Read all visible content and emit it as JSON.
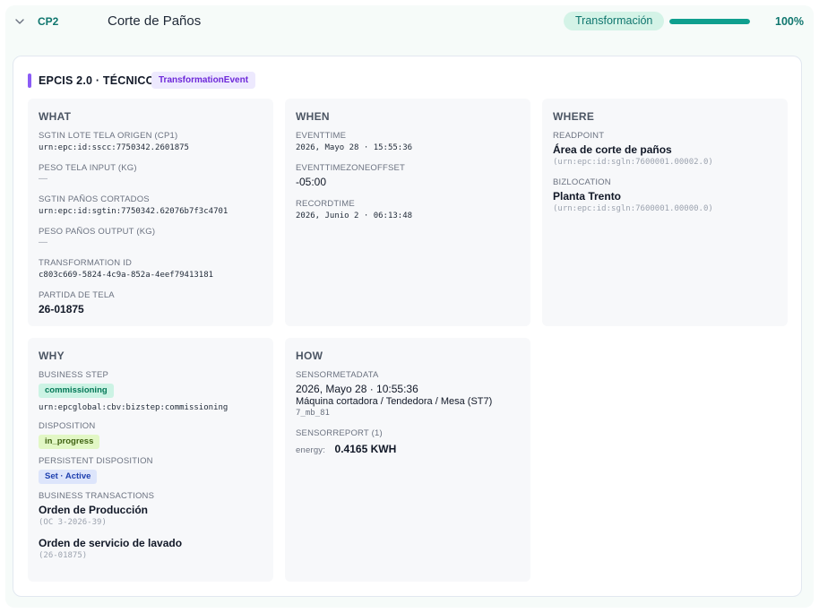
{
  "header": {
    "code": "CP2",
    "title": "Corte de Paños",
    "type_label": "Transformación",
    "progress_percent": 100,
    "progress_label": "100%",
    "accent_color": "#0f9f8f"
  },
  "card": {
    "title": "EPCIS 2.0 · TÉCNICO",
    "event_type": "TransformationEvent",
    "what": {
      "heading": "WHAT",
      "fields": [
        {
          "label": "SGTIN LOTE TELA ORIGEN (CP1)",
          "value": "urn:epc:id:sscc:7750342.2601875"
        },
        {
          "label": "PESO TELA INPUT (KG)",
          "value": "—"
        },
        {
          "label": "SGTIN PAÑOS CORTADOS",
          "value": "urn:epc:id:sgtin:7750342.62076b7f3c4701"
        },
        {
          "label": "PESO PAÑOS OUTPUT (KG)",
          "value": "—"
        },
        {
          "label": "TRANSFORMATION ID",
          "value": "c803c669-5824-4c9a-852a-4eef79413181"
        },
        {
          "label": "PARTIDA DE TELA",
          "value": "26-01875"
        }
      ]
    },
    "when": {
      "heading": "WHEN",
      "event_time_label": "EVENTTIME",
      "event_time": "2026, Mayo 28 · 15:55:36",
      "tz_label": "EVENTTIMEZONEOFFSET",
      "tz": "-05:00",
      "record_time_label": "RECORDTIME",
      "record_time": "2026, Junio 2 · 06:13:48"
    },
    "where": {
      "heading": "WHERE",
      "readpoint_label": "READPOINT",
      "readpoint_name": "Área de corte de paños",
      "readpoint_id": "(urn:epc:id:sgln:7600001.00002.0)",
      "bizlocation_label": "BIZLOCATION",
      "bizlocation_name": "Planta Trento",
      "bizlocation_id": "(urn:epc:id:sgln:7600001.00000.0)"
    },
    "why": {
      "heading": "WHY",
      "business_step_label": "BUSINESS STEP",
      "business_step": "commissioning",
      "business_step_urn": "urn:epcglobal:cbv:bizstep:commissioning",
      "disposition_label": "DISPOSITION",
      "disposition": "in_progress",
      "persistent_label": "PERSISTENT DISPOSITION",
      "persistent": "Set · Active",
      "transactions_label": "BUSINESS TRANSACTIONS",
      "transactions": [
        {
          "name": "Orden de Producción",
          "ref": "(OC 3-2026-39)"
        },
        {
          "name": "Orden de servicio de lavado",
          "ref": "(26-01875)"
        }
      ]
    },
    "how": {
      "heading": "HOW",
      "sensor_meta_label": "SENSORMETADATA",
      "sensor_time": "2026, Mayo 28 · 10:55:36",
      "sensor_device": "Máquina cortadora / Tendedora / Mesa (ST7)",
      "sensor_id": "7_mb_81",
      "sensor_report_label": "SENSORREPORT (1)",
      "energy_label": "energy:",
      "energy_value": "0.4165 KWH"
    }
  }
}
